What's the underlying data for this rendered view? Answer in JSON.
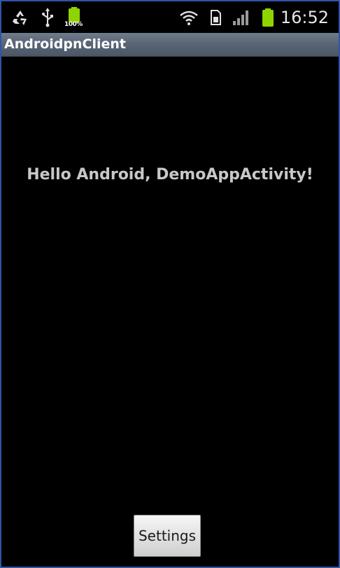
{
  "status_bar": {
    "battery_percent": "100%",
    "time": "16:52",
    "icons": [
      "recycle-icon",
      "usb-icon",
      "battery-charging-icon",
      "wifi-icon",
      "sim-card-icon",
      "signal-strength-icon",
      "battery-icon"
    ],
    "battery_color": "#8fd400"
  },
  "app": {
    "title": "AndroidpnClient",
    "title_bar_color": "#5a6676"
  },
  "main": {
    "message": "Hello Android, DemoAppActivity!"
  },
  "footer": {
    "settings_label": "Settings"
  }
}
